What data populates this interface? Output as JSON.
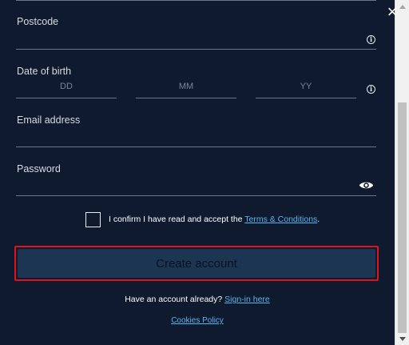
{
  "window": {
    "close_glyph": "×"
  },
  "form": {
    "postcode": {
      "label": "Postcode",
      "value": ""
    },
    "dob": {
      "label": "Date of birth",
      "day_placeholder": "DD",
      "month_placeholder": "MM",
      "year_placeholder": "YY"
    },
    "email": {
      "label": "Email address",
      "value": ""
    },
    "password": {
      "label": "Password",
      "value": ""
    },
    "terms": {
      "checked": false,
      "text": "I confirm I have read and accept the ",
      "link": "Terms & Conditions",
      "suffix": "."
    },
    "create_button": "Create account",
    "signin": {
      "text": "Have an account already? ",
      "link": "Sign-in here"
    },
    "cookies_link": "Cookies Policy",
    "info_glyph": "i"
  },
  "colors": {
    "modal_bg": "#0f1a2e",
    "button_bg": "#1b3553",
    "highlight": "#e0121b",
    "link": "#5ab4f0"
  },
  "icons": [
    "close-icon",
    "info-icon",
    "eye-icon",
    "scroll-up-arrow",
    "scroll-down-arrow"
  ]
}
